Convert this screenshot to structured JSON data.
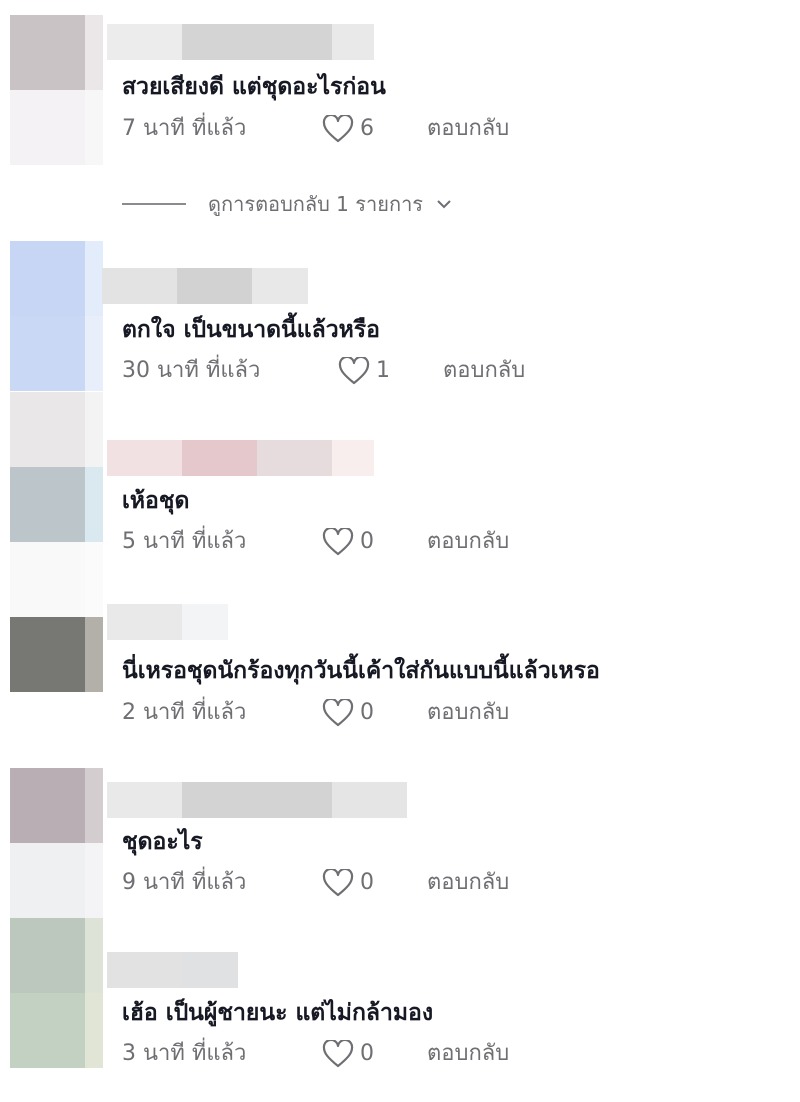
{
  "comments": [
    {
      "text": "สวยเสียงดี แต่ชุดอะไรก่อน",
      "time": "7 นาที ที่แล้ว",
      "likes": "6",
      "reply_label": "ตอบกลับ",
      "view_replies": "ดูการตอบกลับ 1 รายการ"
    },
    {
      "text": "ตกใจ เป็นขนาดนี้แล้วหรือ",
      "time": "30 นาที ที่แล้ว",
      "likes": "1",
      "reply_label": "ตอบกลับ"
    },
    {
      "text": "เห้อชุด",
      "time": "5 นาที ที่แล้ว",
      "likes": "0",
      "reply_label": "ตอบกลับ"
    },
    {
      "text": "นี่เหรอชุดนักร้องทุกวันนี้เค้าใส่กันแบบนี้แล้วเหรอ",
      "time": "2 นาที ที่แล้ว",
      "likes": "0",
      "reply_label": "ตอบกลับ"
    },
    {
      "text": "ชุดอะไร",
      "time": "9 นาที ที่แล้ว",
      "likes": "0",
      "reply_label": "ตอบกลับ"
    },
    {
      "text": "เฮ้อ เป็นผู้ชายนะ แต่ไม่กล้ามอง",
      "time": "3 นาที ที่แล้ว",
      "likes": "0",
      "reply_label": "ตอบกลับ"
    }
  ],
  "colors": {
    "text": "#161823",
    "meta": "#6e6e73"
  }
}
